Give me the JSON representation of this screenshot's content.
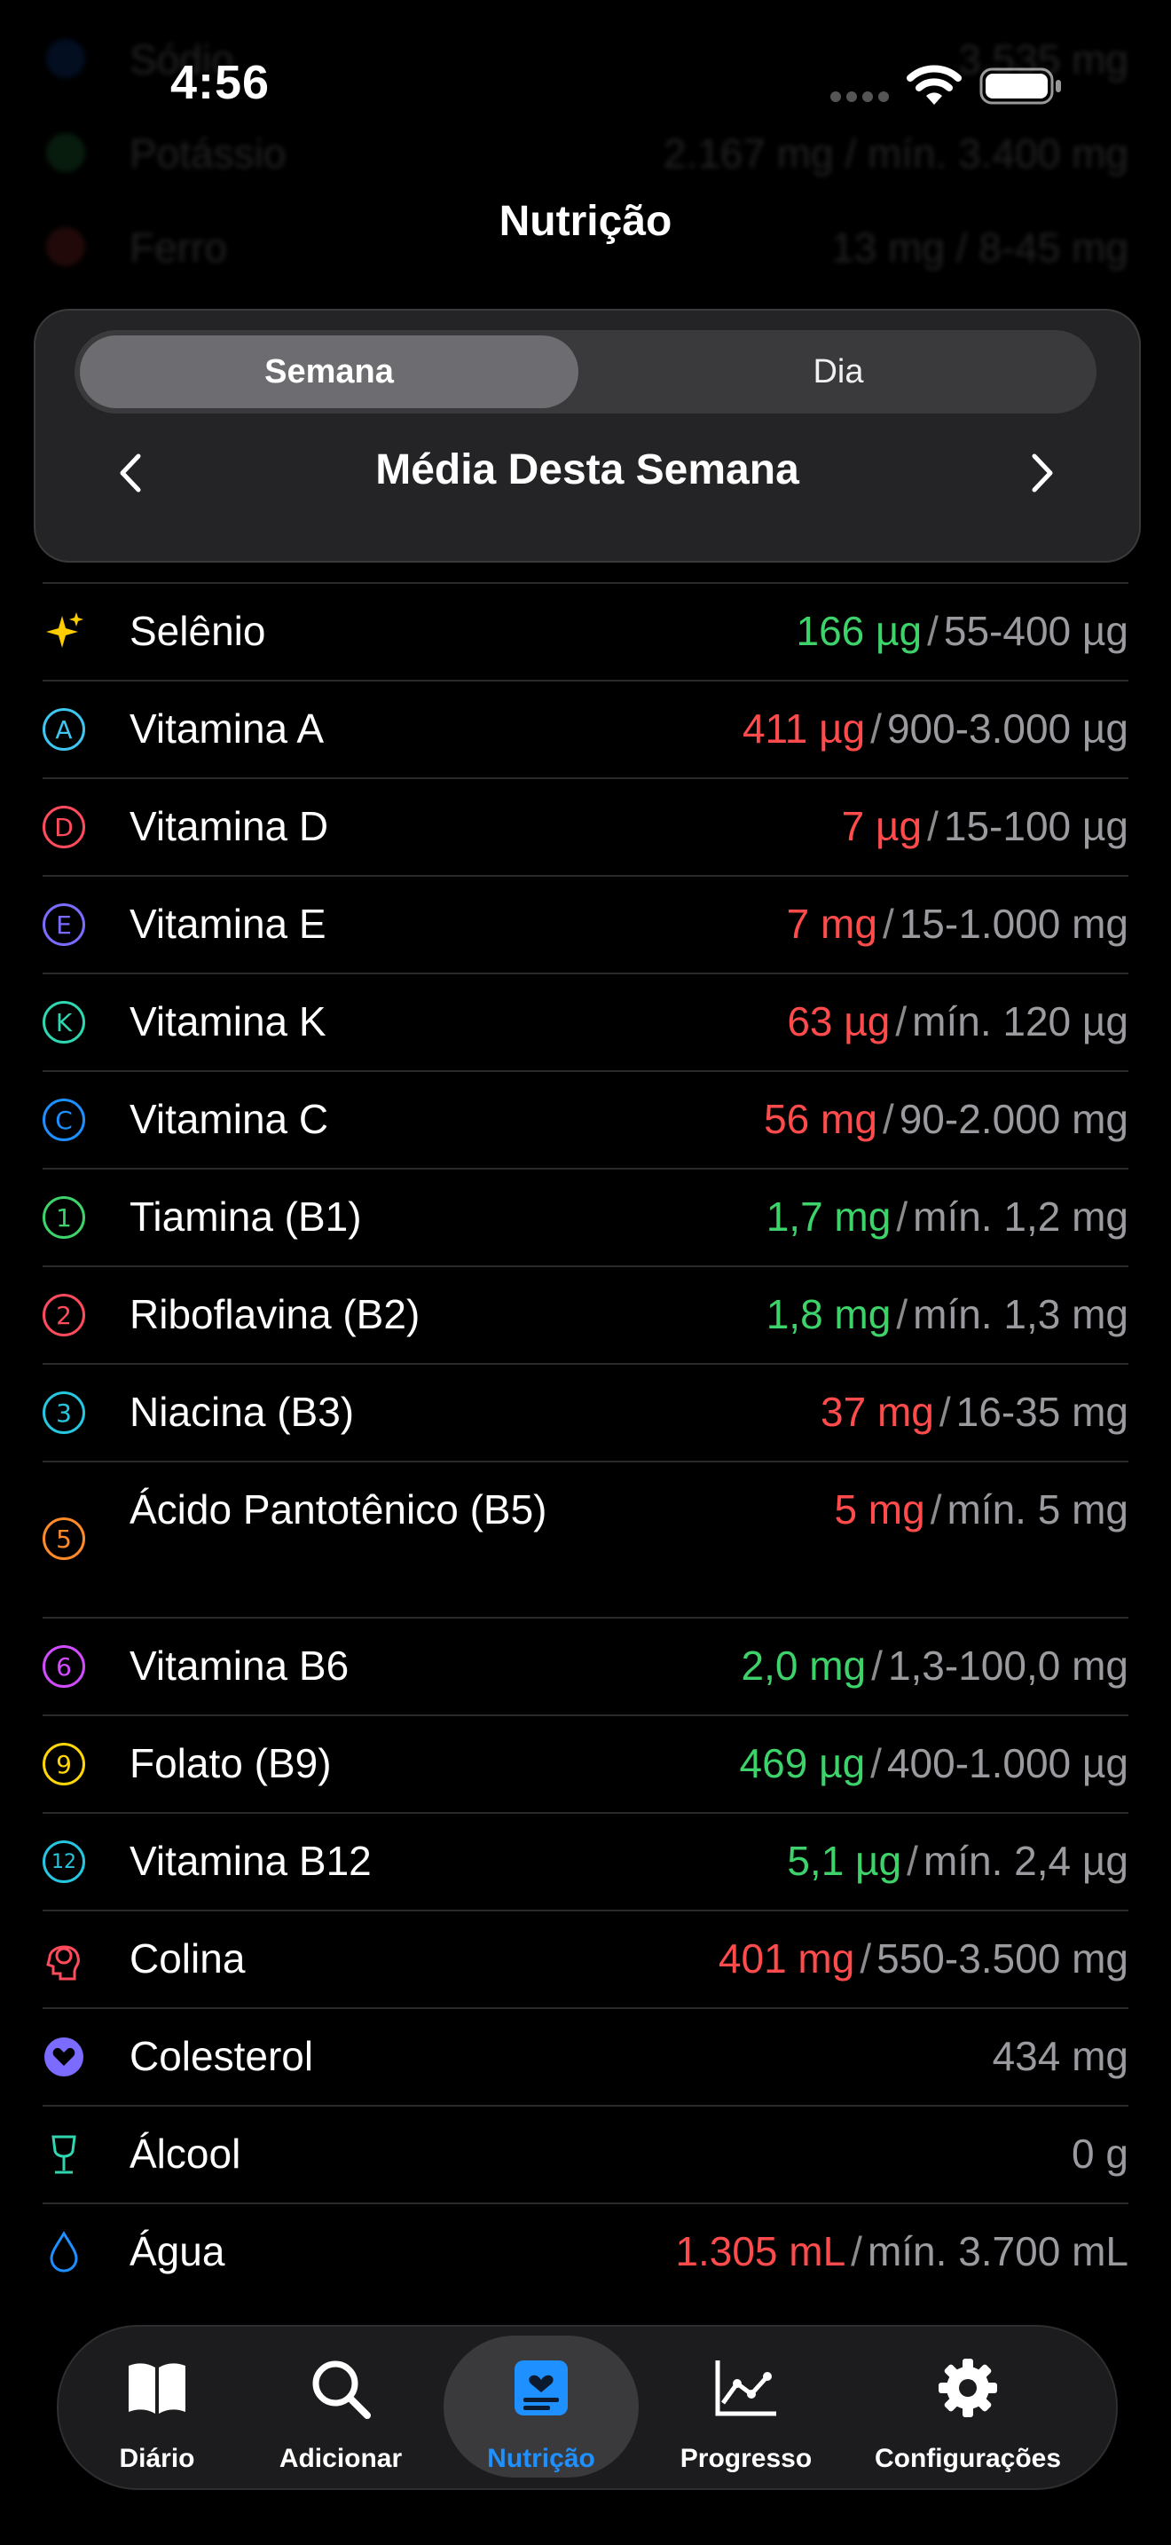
{
  "status": {
    "time": "4:56"
  },
  "header": {
    "title": "Nutrição"
  },
  "ghost_rows": [
    {
      "label": "Sódio",
      "value": "3.535 mg"
    },
    {
      "label": "Potássio",
      "value": "2.167 mg / mín. 3.400 mg"
    },
    {
      "label": "Ferro",
      "value": "13 mg / 8-45 mg"
    }
  ],
  "segment": {
    "week": "Semana",
    "day": "Dia"
  },
  "period": {
    "label": "Média Desta Semana"
  },
  "nutrients": [
    {
      "label": "Selênio",
      "amount": "166 µg",
      "status": "green",
      "range": "55-400 µg",
      "icon": "sparkles-icon"
    },
    {
      "label": "Vitamina A",
      "amount": "411 µg",
      "status": "red",
      "range": "900-3.000 µg",
      "icon": "A",
      "color": "#3ec6f0"
    },
    {
      "label": "Vitamina D",
      "amount": "7 µg",
      "status": "red",
      "range": "15-100 µg",
      "icon": "D",
      "color": "#ff4b5c"
    },
    {
      "label": "Vitamina E",
      "amount": "7 mg",
      "status": "red",
      "range": "15-1.000 mg",
      "icon": "E",
      "color": "#7b6cff"
    },
    {
      "label": "Vitamina K",
      "amount": "63 µg",
      "status": "red",
      "range": "mín. 120 µg",
      "icon": "K",
      "color": "#2fd6b0"
    },
    {
      "label": "Vitamina C",
      "amount": "56 mg",
      "status": "red",
      "range": "90-2.000 mg",
      "icon": "C",
      "color": "#1e8fff"
    },
    {
      "label": "Tiamina (B1)",
      "amount": "1,7 mg",
      "status": "green",
      "range": "mín. 1,2 mg",
      "icon": "1",
      "color": "#3dd36a"
    },
    {
      "label": "Riboflavina (B2)",
      "amount": "1,8 mg",
      "status": "green",
      "range": "mín. 1,3 mg",
      "icon": "2",
      "color": "#ff4b5c"
    },
    {
      "label": "Niacina (B3)",
      "amount": "37 mg",
      "status": "red",
      "range": "16-35 mg",
      "icon": "3",
      "color": "#27c6e0"
    },
    {
      "label": "Ácido Pantotênico (B5)",
      "amount": "5 mg",
      "status": "red",
      "range": "mín. 5 mg",
      "icon": "5",
      "color": "#ff8a2a",
      "tall": true
    },
    {
      "label": "Vitamina B6",
      "amount": "2,0 mg",
      "status": "green",
      "range": "1,3-100,0 mg",
      "icon": "6",
      "color": "#d24bff"
    },
    {
      "label": "Folato (B9)",
      "amount": "469 µg",
      "status": "green",
      "range": "400-1.000 µg",
      "icon": "9",
      "color": "#ffd60a"
    },
    {
      "label": "Vitamina B12",
      "amount": "5,1 µg",
      "status": "green",
      "range": "mín. 2,4 µg",
      "icon": "12",
      "color": "#27c6e0"
    },
    {
      "label": "Colina",
      "amount": "401 mg",
      "status": "red",
      "range": "550-3.500 mg",
      "icon": "brain-head-icon"
    },
    {
      "label": "Colesterol",
      "amount": "434 mg",
      "status": "gray",
      "range": "",
      "icon": "heart-icon"
    },
    {
      "label": "Álcool",
      "amount": "0 g",
      "status": "gray",
      "range": "",
      "icon": "wine-glass-icon"
    },
    {
      "label": "Água",
      "amount": "1.305 mL",
      "status": "red",
      "range": "mín. 3.700 mL",
      "icon": "water-drop-icon"
    }
  ],
  "tabs": [
    {
      "label": "Diário",
      "icon": "book-icon"
    },
    {
      "label": "Adicionar",
      "icon": "search-icon"
    },
    {
      "label": "Nutrição",
      "icon": "nutrition-icon",
      "active": true
    },
    {
      "label": "Progresso",
      "icon": "chart-icon"
    },
    {
      "label": "Configurações",
      "icon": "gear-icon"
    }
  ],
  "colors": {
    "green": "#3dd36a",
    "red": "#ff4b4b",
    "accent": "#1e90ff"
  }
}
